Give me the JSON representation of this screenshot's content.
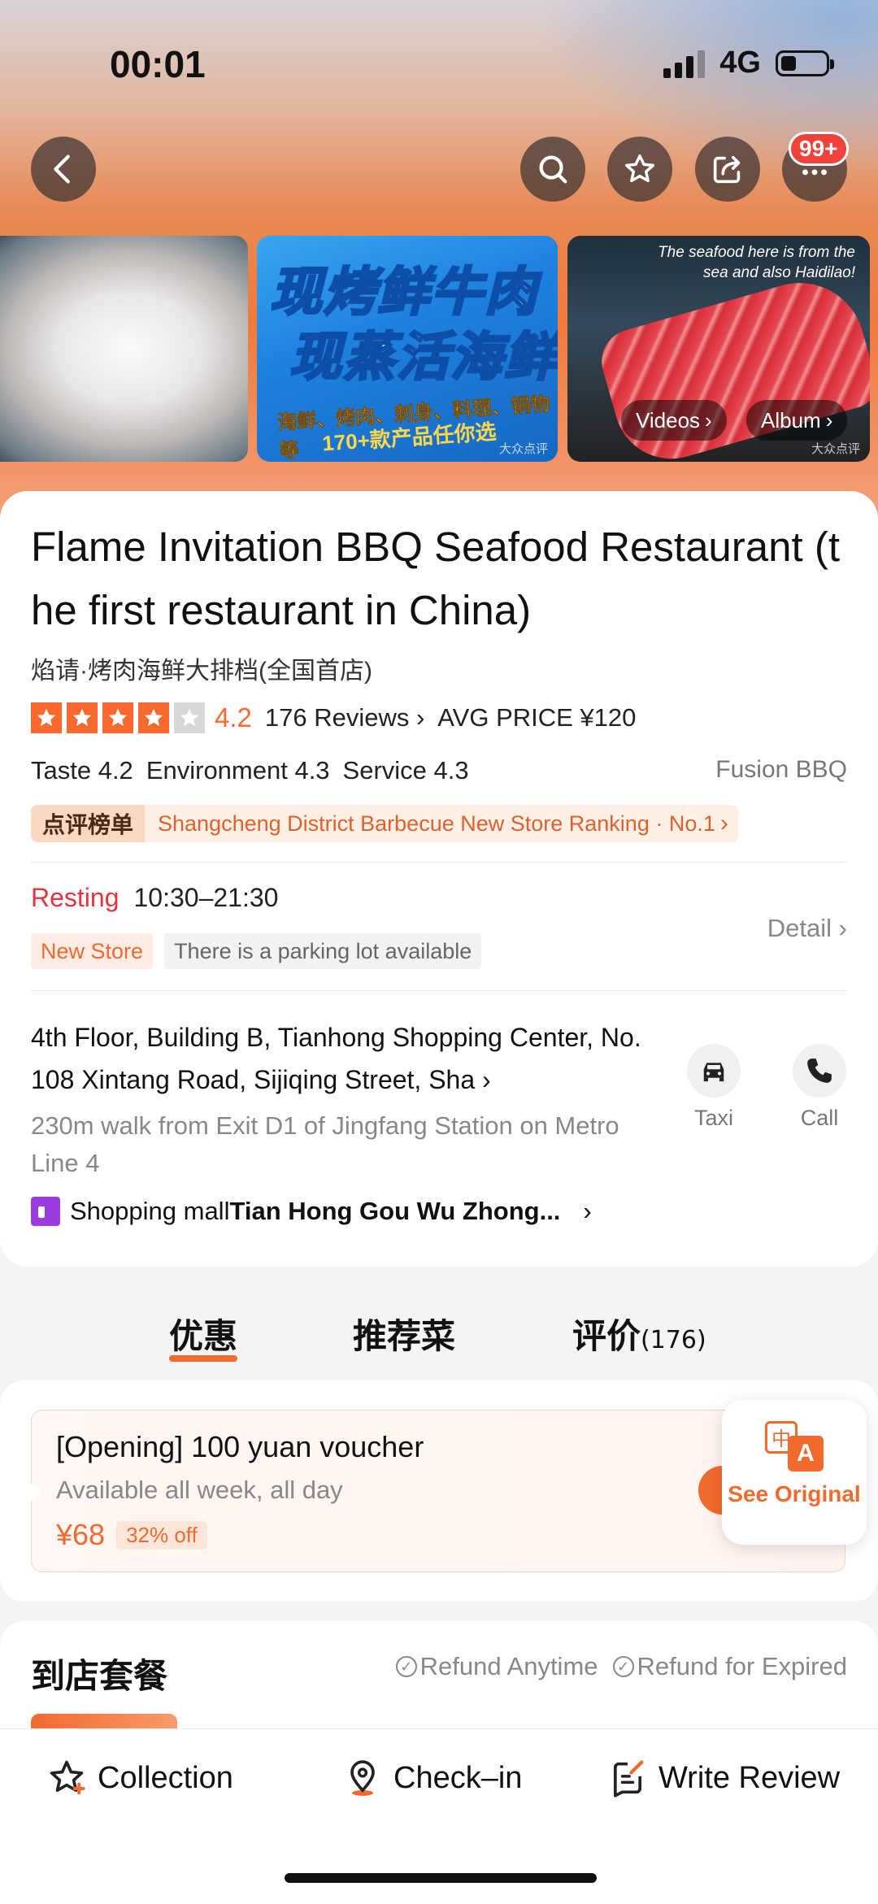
{
  "status_bar": {
    "time": "00:01",
    "network": "4G"
  },
  "nav": {
    "badge": "99+"
  },
  "photos": {
    "promo_line1": "现烤鲜牛肉",
    "promo_line2": "现蒸活海鲜",
    "promo_sub": "海鲜、烤肉、刺身、料理、锅物等",
    "promo_sub2": "170+款产品任你选",
    "caption_line1": "The seafood here is from the",
    "caption_line2": "sea and also Haidilao!",
    "videos_label": "Videos",
    "album_label": "Album",
    "watermark": "大众点评"
  },
  "shop": {
    "title": "Flame Invitation BBQ Seafood Restaurant (the first restaurant in China)",
    "subtitle": "焰请·烤肉海鲜大排档(全国首店)",
    "stars": 4.2,
    "score": "4.2",
    "reviews": "176 Reviews",
    "avg_price": "AVG PRICE ¥120",
    "taste": "Taste 4.2",
    "environment": "Environment 4.3",
    "service": "Service 4.3",
    "cuisine": "Fusion BBQ",
    "rank_tag": "点评榜单",
    "rank_text": "Shangcheng District Barbecue New Store Ranking · No.1",
    "status": "Resting",
    "hours": "10:30–21:30",
    "tag_new": "New Store",
    "tag_parking": "There is a parking lot available",
    "detail": "Detail",
    "address": "4th Floor, Building B, Tianhong Shopping Center, No. 108 Xintang Road, Sijiqing Street, Sha",
    "walk": "230m walk from Exit D1 of Jingfang Station on Metro Line 4",
    "mall_prefix": "Shopping mall",
    "mall_name": "Tian Hong Gou Wu Zhong...",
    "taxi": "Taxi",
    "call": "Call"
  },
  "tabs": [
    {
      "label": "优惠"
    },
    {
      "label": "推荐菜"
    },
    {
      "label": "评价",
      "count": "(176)"
    }
  ],
  "voucher": {
    "title": "[Opening] 100 yuan voucher",
    "subtitle": "Available all week, all day",
    "price": "¥68",
    "discount": "32% off"
  },
  "translate": {
    "zh": "中",
    "en": "A",
    "label": "See Original"
  },
  "set_meal": {
    "title": "到店套餐",
    "refund1": "Refund Anytime",
    "refund2": "Refund for Expired"
  },
  "bottom_bar": {
    "collection": "Collection",
    "checkin": "Check–in",
    "write_review": "Write Review"
  },
  "colors": {
    "accent": "#f26a2e",
    "resting": "#e6343f",
    "mall_icon": "#9a3ce0"
  }
}
